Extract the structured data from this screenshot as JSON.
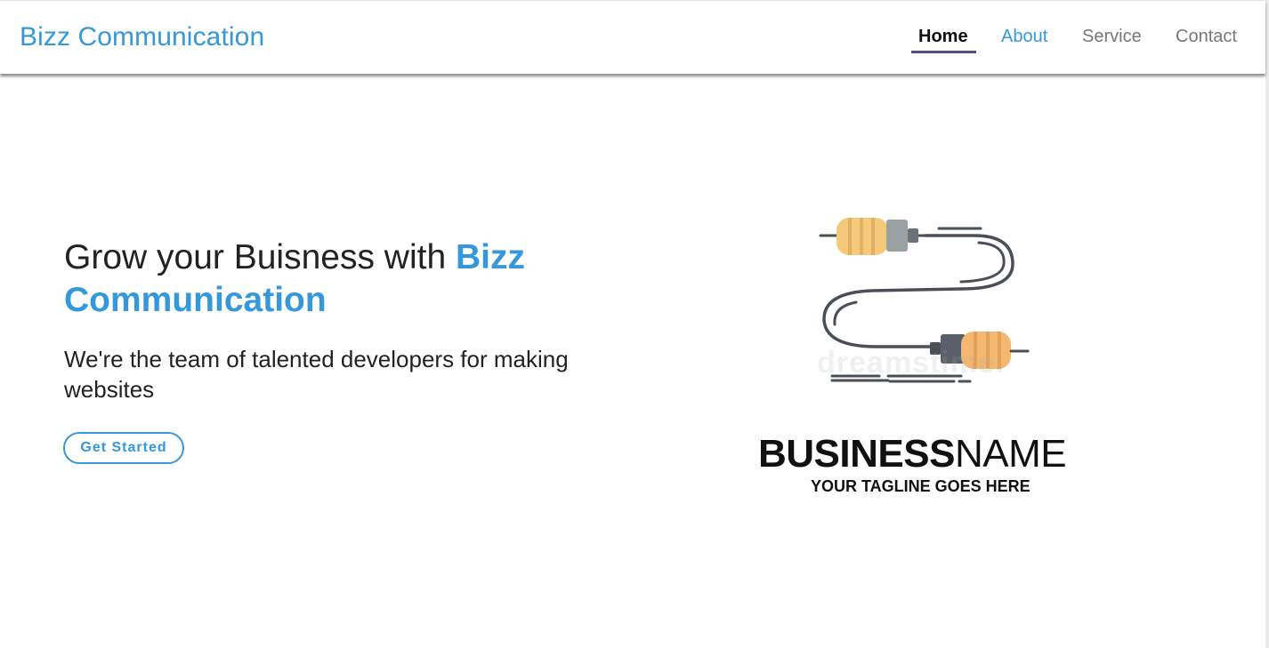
{
  "navbar": {
    "brand": "Bizz Communication",
    "items": [
      {
        "label": "Home",
        "active": true
      },
      {
        "label": "About"
      },
      {
        "label": "Service"
      },
      {
        "label": "Contact"
      }
    ]
  },
  "hero": {
    "title_prefix": "Grow your Buisness with ",
    "title_accent": "Bizz Communication",
    "subtitle": "We're the team of talented developers for making websites",
    "cta_label": "Get Started"
  },
  "logo": {
    "name_bold": "BUSINESS",
    "name_light": "NAME",
    "tagline": "YOUR TAGLINE GOES HERE",
    "watermark": "dreamstime."
  },
  "colors": {
    "accent": "#3498db",
    "active_underline": "#5a4a8a",
    "text": "#222222",
    "muted_nav": "#777777"
  }
}
